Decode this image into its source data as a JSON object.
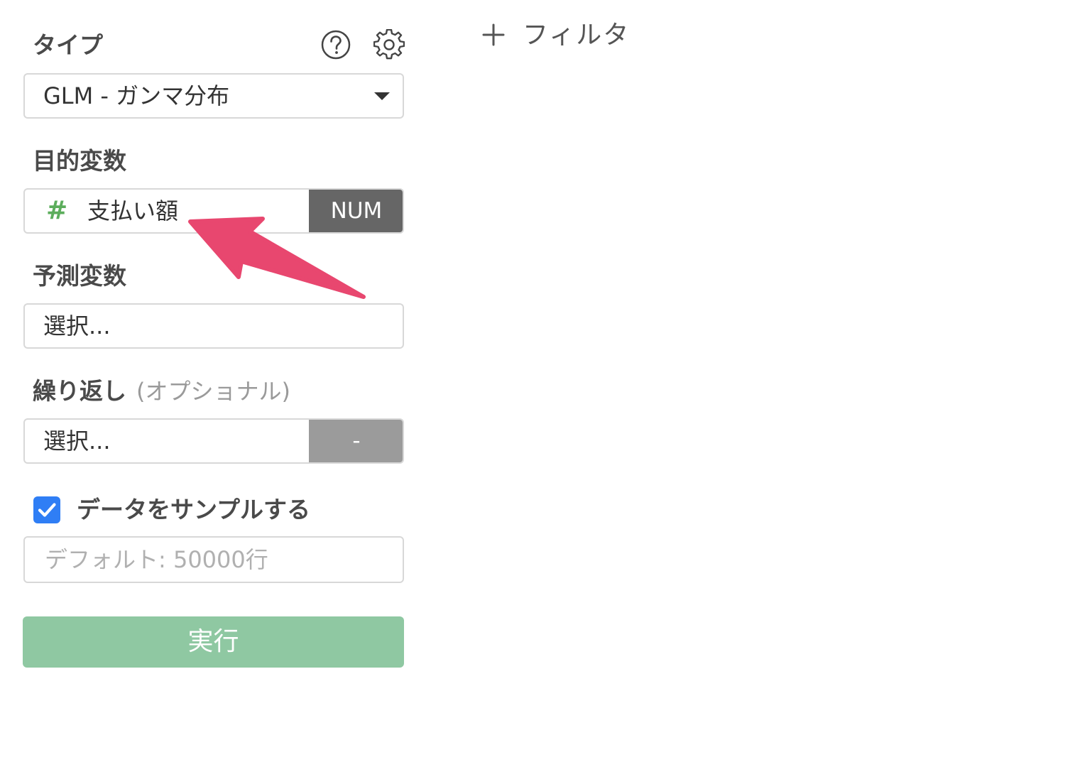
{
  "type_section": {
    "label": "タイプ",
    "selected_value": "GLM - ガンマ分布"
  },
  "target_section": {
    "label": "目的変数",
    "column_icon": "#",
    "column_name": "支払い額",
    "column_type": "NUM"
  },
  "predictor_section": {
    "label": "予測変数",
    "placeholder": "選択..."
  },
  "repeat_section": {
    "label": "繰り返し",
    "optional_label": "(オプショナル)",
    "placeholder": "選択...",
    "type_badge": "-"
  },
  "sample_section": {
    "checkbox_label": "データをサンプルする",
    "checked": true,
    "input_placeholder": "デフォルト: 50000行",
    "input_value": ""
  },
  "run_button": {
    "label": "実行"
  },
  "filter": {
    "add_label": "フィルタ"
  },
  "icons": {
    "help": "help-circle-icon",
    "settings": "gear-icon",
    "dropdown": "caret-down-icon",
    "check": "check-icon",
    "plus": "plus-icon",
    "annotation": "arrow-icon"
  },
  "colors": {
    "accent_green": "#8fc8a2",
    "hash_green": "#5cad5c",
    "checkbox_blue": "#2f7ef5",
    "badge_dark": "#666666",
    "badge_light": "#9b9b9b",
    "arrow_pink": "#e8476f"
  }
}
